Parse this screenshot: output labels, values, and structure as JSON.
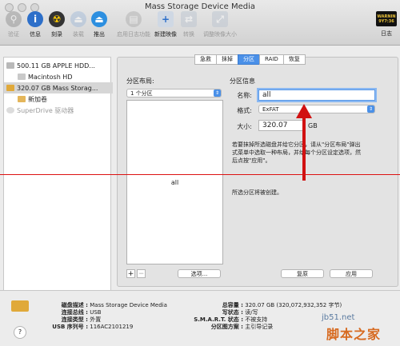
{
  "window": {
    "title": "Mass Storage Device Media"
  },
  "toolbar": {
    "items": [
      {
        "label": "验证",
        "icon": "microscope-icon",
        "enabled": false
      },
      {
        "label": "信息",
        "icon": "info-icon",
        "enabled": true
      },
      {
        "label": "刻录",
        "icon": "burn-icon",
        "enabled": true
      },
      {
        "label": "装载",
        "icon": "mount-icon",
        "enabled": false
      },
      {
        "label": "推出",
        "icon": "eject-icon",
        "enabled": true
      },
      {
        "label": "启用日志功能",
        "icon": "journal-icon",
        "enabled": false
      },
      {
        "label": "新建映像",
        "icon": "new-image-icon",
        "enabled": true
      },
      {
        "label": "转换",
        "icon": "convert-icon",
        "enabled": false
      },
      {
        "label": "调整映像大小",
        "icon": "resize-icon",
        "enabled": false
      }
    ],
    "log": {
      "label": "日志",
      "icon_text": "WARNIN\n9Y7:36"
    }
  },
  "sidebar": {
    "items": [
      {
        "label": "500.11 GB APPLE HDD...",
        "icon": "hard-disk-icon"
      },
      {
        "label": "Macintosh HD",
        "icon": "volume-icon"
      },
      {
        "label": "320.07 GB Mass Storag...",
        "icon": "external-disk-icon",
        "selected": true
      },
      {
        "label": "新加卷",
        "icon": "volume-icon"
      },
      {
        "label": "SuperDrive 驱动器",
        "icon": "optical-drive-icon",
        "disabled": true
      }
    ]
  },
  "tabs": [
    {
      "label": "急救"
    },
    {
      "label": "抹掉"
    },
    {
      "label": "分区",
      "active": true
    },
    {
      "label": "RAID"
    },
    {
      "label": "恢复"
    }
  ],
  "partition": {
    "layout_title": "分区布局:",
    "layout_select": "1 个分区",
    "partition_label": "all",
    "info_title": "分区信息",
    "name_label": "名称:",
    "name_value": "all",
    "format_label": "格式:",
    "format_value": "ExFAT",
    "size_label": "大小:",
    "size_value": "320.07",
    "size_unit": "GB",
    "description": "若要抹掉所选磁盘并给它分区，请从\"分区布局\"弹出式菜单中选取一种布局，并给每个分区设定选项，然后点按\"应用\"。",
    "status": "所选分区将被创建。",
    "options_button": "选项...",
    "revert_button": "复原",
    "apply_button": "应用",
    "add_button": "+",
    "remove_button": "−"
  },
  "info": {
    "rows_left": [
      {
        "key": "磁盘描述 :",
        "value": "Mass Storage Device Media"
      },
      {
        "key": "连接总线 :",
        "value": "USB"
      },
      {
        "key": "连接类型 :",
        "value": "外置"
      },
      {
        "key": "USB 序列号 :",
        "value": "116AC2101219"
      }
    ],
    "rows_right": [
      {
        "key": "总容量 :",
        "value": "320.07 GB (320,072,932,352 字节)"
      },
      {
        "key": "写状态 :",
        "value": "读/写"
      },
      {
        "key": "S.M.A.R.T. 状态 :",
        "value": "不被支持"
      },
      {
        "key": "分区图方案 :",
        "value": "主引导记录"
      }
    ],
    "help": "?"
  },
  "watermark": {
    "site": "jb51.net",
    "brand": "脚本之家"
  },
  "colors": {
    "accent": "#4a90e8",
    "annotation": "#d11111"
  }
}
